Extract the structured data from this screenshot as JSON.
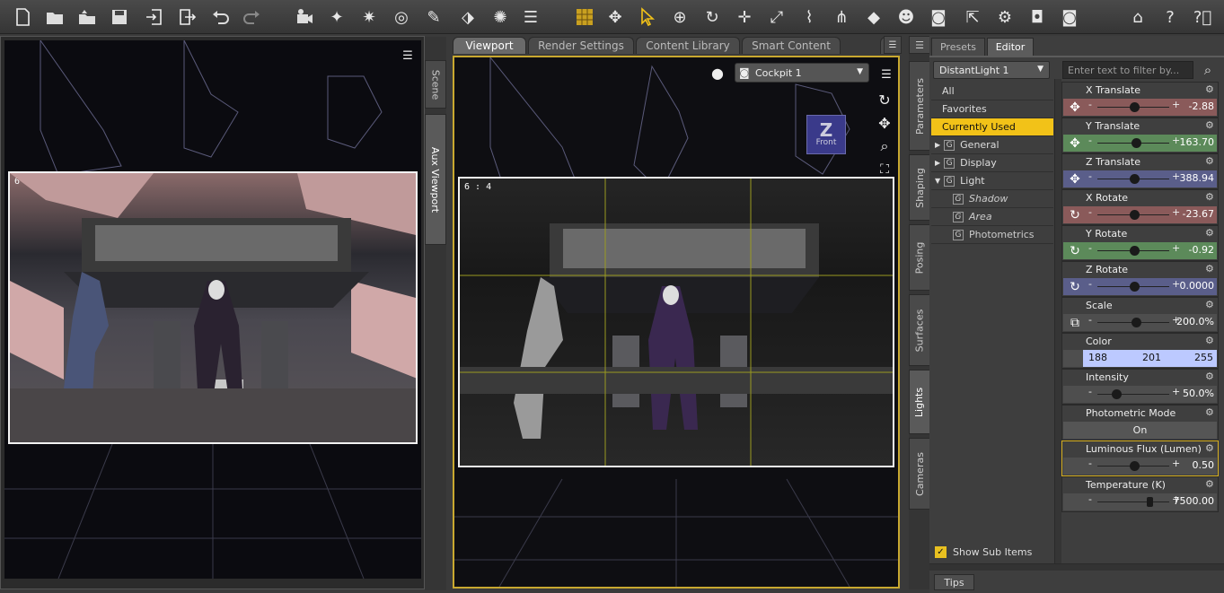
{
  "toolbar": {
    "icons": [
      "new-file",
      "open-file",
      "open-folder",
      "save",
      "import",
      "export",
      "undo",
      "redo",
      "camera-add",
      "light-spot",
      "light-point",
      "light-distant",
      "light-linear",
      "light-uber",
      "light-sun",
      "select-icon",
      "grid-toggle",
      "universal-tool",
      "pointer-tool",
      "rotate-tool",
      "translate-tool",
      "scale-tool",
      "joint-editor",
      "bend-tool",
      "surface-tool",
      "figure-tool",
      "render-camera",
      "render-settings",
      "render-quick",
      "render-window",
      "home-icon",
      "help-cursor",
      "help-icon"
    ]
  },
  "aux_viewport": {
    "aspect": "6 : 4",
    "tabs": [
      "Scene",
      "Aux Viewport"
    ]
  },
  "tabs": {
    "items": [
      "Viewport",
      "Render Settings",
      "Content Library",
      "Smart Content"
    ]
  },
  "viewport": {
    "camera": "Cockpit 1",
    "aspect": "6 : 4",
    "view_cube": "Front"
  },
  "side_tabs": [
    "Parameters",
    "Shaping",
    "Posing",
    "Surfaces",
    "Lights",
    "Cameras"
  ],
  "panel": {
    "tabs": [
      "Presets",
      "Editor"
    ],
    "node": "DistantLight 1",
    "filter_placeholder": "Enter text to filter by...",
    "tree": {
      "all": "All",
      "favorites": "Favorites",
      "current": "Currently Used",
      "general": "General",
      "display": "Display",
      "light": "Light",
      "shadow": "Shadow",
      "area": "Area",
      "photometrics": "Photometrics"
    },
    "show_sub": "Show Sub Items",
    "footer_tab": "Tips",
    "params": [
      {
        "label": "X Translate",
        "value": "-2.88",
        "pos": 0.5,
        "color": "#8a5a5a"
      },
      {
        "label": "Y Translate",
        "value": "163.70",
        "pos": 0.52,
        "color": "#5c8a5a"
      },
      {
        "label": "Z Translate",
        "value": "388.94",
        "pos": 0.5,
        "color": "#5a5e8a"
      },
      {
        "label": "X Rotate",
        "value": "-23.67",
        "pos": 0.5,
        "color": "#8a5a5a"
      },
      {
        "label": "Y Rotate",
        "value": "-0.92",
        "pos": 0.5,
        "color": "#5c8a5a"
      },
      {
        "label": "Z Rotate",
        "value": "0.0000",
        "pos": 0.5,
        "color": "#5a5e8a"
      },
      {
        "label": "Scale",
        "value": "200.0%",
        "pos": 0.52,
        "color": "#5a5a5a"
      },
      {
        "label": "Intensity",
        "value": "50.0%",
        "pos": 0.35,
        "color": "#5a5a5a"
      },
      {
        "label": "Luminous Flux (Lumen)",
        "value": "0.50",
        "pos": 0.5,
        "color": "#5a5a5a"
      },
      {
        "label": "Temperature (K)",
        "value": "7500.00",
        "pos": 0.82,
        "color": "#5a5a5a"
      }
    ],
    "color": {
      "label": "Color",
      "r": "188",
      "g": "201",
      "b": "255"
    },
    "photometric": {
      "label": "Photometric Mode",
      "value": "On"
    }
  }
}
